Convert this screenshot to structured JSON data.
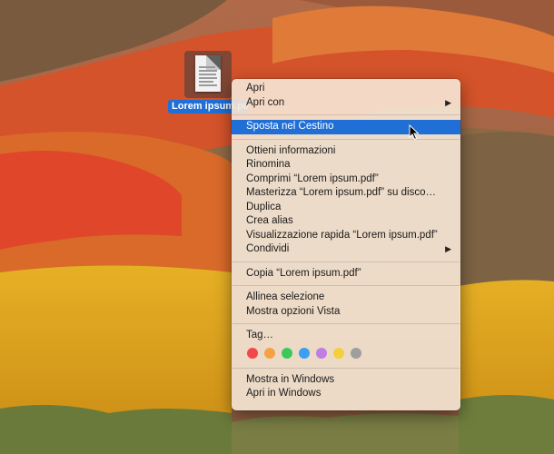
{
  "desktop": {
    "file_label": "Lorem ipsum.pdf"
  },
  "menu": {
    "groups": [
      [
        {
          "label": "Apri",
          "submenu": false
        },
        {
          "label": "Apri con",
          "submenu": true
        }
      ],
      [
        {
          "label": "Sposta nel Cestino",
          "submenu": false,
          "highlighted": true
        }
      ],
      [
        {
          "label": "Ottieni informazioni",
          "submenu": false
        },
        {
          "label": "Rinomina",
          "submenu": false
        },
        {
          "label": "Comprimi “Lorem ipsum.pdf”",
          "submenu": false
        },
        {
          "label": "Masterizza “Lorem ipsum.pdf” su disco…",
          "submenu": false
        },
        {
          "label": "Duplica",
          "submenu": false
        },
        {
          "label": "Crea alias",
          "submenu": false
        },
        {
          "label": "Visualizzazione rapida “Lorem ipsum.pdf”",
          "submenu": false
        },
        {
          "label": "Condividi",
          "submenu": true
        }
      ],
      [
        {
          "label": "Copia “Lorem ipsum.pdf”",
          "submenu": false
        }
      ],
      [
        {
          "label": "Allinea selezione",
          "submenu": false
        },
        {
          "label": "Mostra opzioni Vista",
          "submenu": false
        }
      ],
      [
        {
          "label": "Tag…",
          "submenu": false
        }
      ],
      [
        {
          "label": "Mostra in Windows",
          "submenu": false
        },
        {
          "label": "Apri in Windows",
          "submenu": false
        }
      ]
    ],
    "tag_colors": [
      {
        "name": "red",
        "hex": "#f0484c"
      },
      {
        "name": "orange",
        "hex": "#f6a144"
      },
      {
        "name": "green",
        "hex": "#3dc95a"
      },
      {
        "name": "blue",
        "hex": "#3a9ff5"
      },
      {
        "name": "purple",
        "hex": "#c07de2"
      },
      {
        "name": "yellow",
        "hex": "#f3cf3d"
      },
      {
        "name": "gray",
        "hex": "#9e9e9e"
      }
    ],
    "submenu_arrow": "▶"
  }
}
